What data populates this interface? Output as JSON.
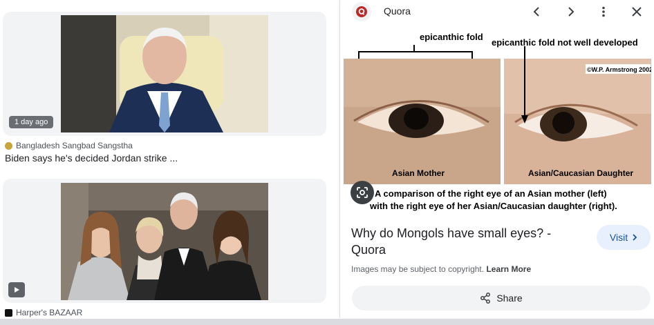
{
  "results": [
    {
      "time_badge": "1 day ago",
      "source": "Bangladesh Sangbad Sangstha",
      "title": "Biden says he's decided Jordan strike ..."
    },
    {
      "source": "Harper's BAZAAR"
    }
  ],
  "panel": {
    "site_name": "Quora",
    "image_labels": {
      "fold_left": "epicanthic fold",
      "fold_right": "epicanthic fold not well developed",
      "copyright": "©W.P. Armstrong 2002",
      "photo_left": "Asian Mother",
      "photo_right": "Asian/Caucasian Daughter",
      "caption_line1": "A comparison of the right eye of an Asian mother (left)",
      "caption_line2": "with the right eye of her Asian/Caucasian daughter (right)."
    },
    "result_title": "Why do Mongols have small eyes? - Quora",
    "visit_label": "Visit",
    "copyright_text": "Images may be subject to copyright.",
    "learn_more": "Learn More",
    "share_label": "Share"
  },
  "colors": {
    "quora_red": "#b92b27",
    "visit_bg": "#e8f0fe",
    "visit_text": "#1a4fa0"
  }
}
